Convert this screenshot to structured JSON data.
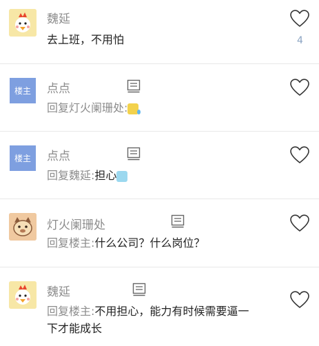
{
  "comments": [
    {
      "name": "魏延",
      "avatar": "chick-avatar",
      "body": "去上班，不用怕",
      "likes": "4"
    },
    {
      "name": "点点",
      "avatar_label": "楼主",
      "reply_prefix": "回复灯火阑珊处:",
      "emoji": "tired-face-emoji"
    },
    {
      "name": "点点",
      "avatar_label": "楼主",
      "reply_prefix": "回复魏延:",
      "body": "担心",
      "emoji": "teary-face-emoji"
    },
    {
      "name": "灯火阑珊处",
      "avatar": "cat-avatar",
      "reply_prefix": "回复楼主:",
      "body": "什么公司？什么岗位？"
    },
    {
      "name": "魏延",
      "avatar": "chick-avatar",
      "reply_prefix": "回复楼主:",
      "body_line1": "不用担心，能力有时候需要逼一",
      "body_line2": "下才能成长"
    }
  ],
  "colors": {
    "name_gray": "#8c8c8c",
    "badge_blue": "#7e9fe0",
    "like_count_blue": "#8aa3c2",
    "divider": "#e8e8e8"
  },
  "icons": [
    "heart-icon",
    "comment-icon"
  ]
}
